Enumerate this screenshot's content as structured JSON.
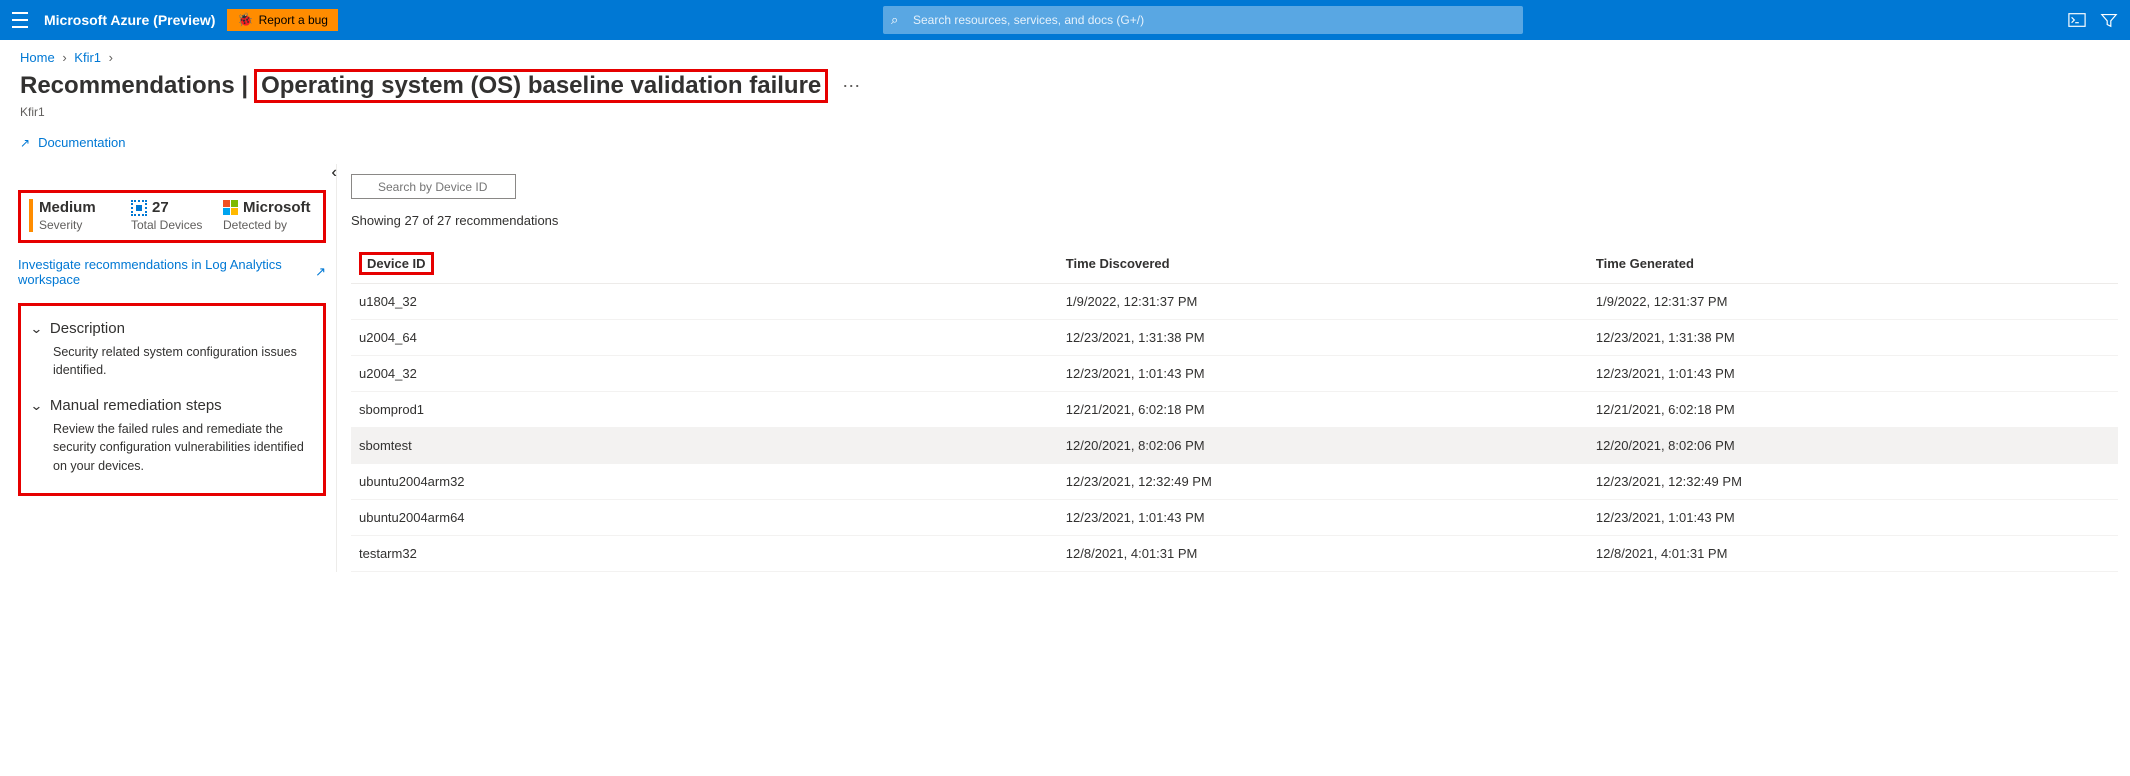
{
  "header": {
    "brand": "Microsoft Azure (Preview)",
    "report_bug": "Report a bug",
    "search_placeholder": "Search resources, services, and docs (G+/)"
  },
  "breadcrumb": {
    "items": [
      "Home",
      "Kfir1"
    ]
  },
  "page": {
    "title_prefix": "Recommendations |",
    "title_highlight": "Operating system (OS) baseline validation failure",
    "subtitle": "Kfir1",
    "documentation": "Documentation"
  },
  "stats": {
    "severity_value": "Medium",
    "severity_label": "Severity",
    "total_value": "27",
    "total_label": "Total Devices",
    "detected_value": "Microsoft",
    "detected_label": "Detected by"
  },
  "investigate_link": "Investigate recommendations in Log Analytics workspace",
  "sections": {
    "description_title": "Description",
    "description_body": "Security related system configuration issues identified.",
    "remediation_title": "Manual remediation steps",
    "remediation_body": "Review the failed rules and remediate the security configuration vulnerabilities identified on your devices."
  },
  "right": {
    "search_placeholder": "Search by Device ID",
    "showing": "Showing 27 of 27 recommendations",
    "columns": {
      "device": "Device ID",
      "discovered": "Time Discovered",
      "generated": "Time Generated"
    },
    "rows": [
      {
        "device": "u1804_32",
        "discovered": "1/9/2022, 12:31:37 PM",
        "generated": "1/9/2022, 12:31:37 PM"
      },
      {
        "device": "u2004_64",
        "discovered": "12/23/2021, 1:31:38 PM",
        "generated": "12/23/2021, 1:31:38 PM"
      },
      {
        "device": "u2004_32",
        "discovered": "12/23/2021, 1:01:43 PM",
        "generated": "12/23/2021, 1:01:43 PM"
      },
      {
        "device": "sbomprod1",
        "discovered": "12/21/2021, 6:02:18 PM",
        "generated": "12/21/2021, 6:02:18 PM"
      },
      {
        "device": "sbomtest",
        "discovered": "12/20/2021, 8:02:06 PM",
        "generated": "12/20/2021, 8:02:06 PM",
        "hover": true
      },
      {
        "device": "ubuntu2004arm32",
        "discovered": "12/23/2021, 12:32:49 PM",
        "generated": "12/23/2021, 12:32:49 PM"
      },
      {
        "device": "ubuntu2004arm64",
        "discovered": "12/23/2021, 1:01:43 PM",
        "generated": "12/23/2021, 1:01:43 PM"
      },
      {
        "device": "testarm32",
        "discovered": "12/8/2021, 4:01:31 PM",
        "generated": "12/8/2021, 4:01:31 PM"
      }
    ]
  }
}
